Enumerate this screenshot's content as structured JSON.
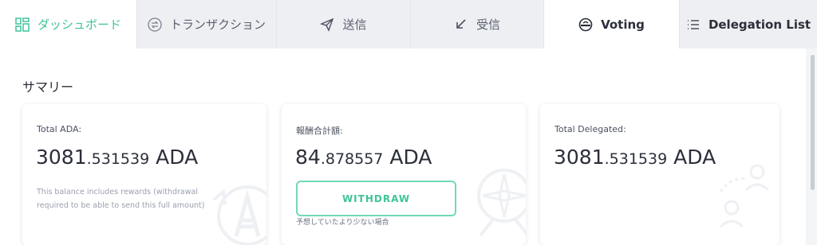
{
  "tabs": [
    {
      "label": "ダッシュボード",
      "icon": "dashboard-grid-icon"
    },
    {
      "label": "トランザクション",
      "icon": "exchange-arrows-icon"
    },
    {
      "label": "送信",
      "icon": "send-plane-icon"
    },
    {
      "label": "受信",
      "icon": "receive-arrow-icon"
    },
    {
      "label": "Voting",
      "icon": "voting-ballot-icon"
    },
    {
      "label": "Delegation List",
      "icon": "list-icon"
    }
  ],
  "summary": {
    "title": "サマリー",
    "total_ada": {
      "label": "Total ADA:",
      "amount_int": "3081",
      "amount_dec": ".531539",
      "unit": "ADA",
      "note": "This balance includes rewards (withdrawal required to be able to send this full amount)"
    },
    "rewards": {
      "label": "報酬合計額:",
      "amount_int": "84",
      "amount_dec": ".878557",
      "unit": "ADA",
      "withdraw_label": "WITHDRAW",
      "hint": "予想していたより少ない場合"
    },
    "total_delegated": {
      "label": "Total Delegated:",
      "amount_int": "3081",
      "amount_dec": ".531539",
      "unit": "ADA"
    }
  },
  "colors": {
    "accent": "#3fc49a",
    "tab_bg": "#eeeff2",
    "text": "#2b2f3a"
  }
}
